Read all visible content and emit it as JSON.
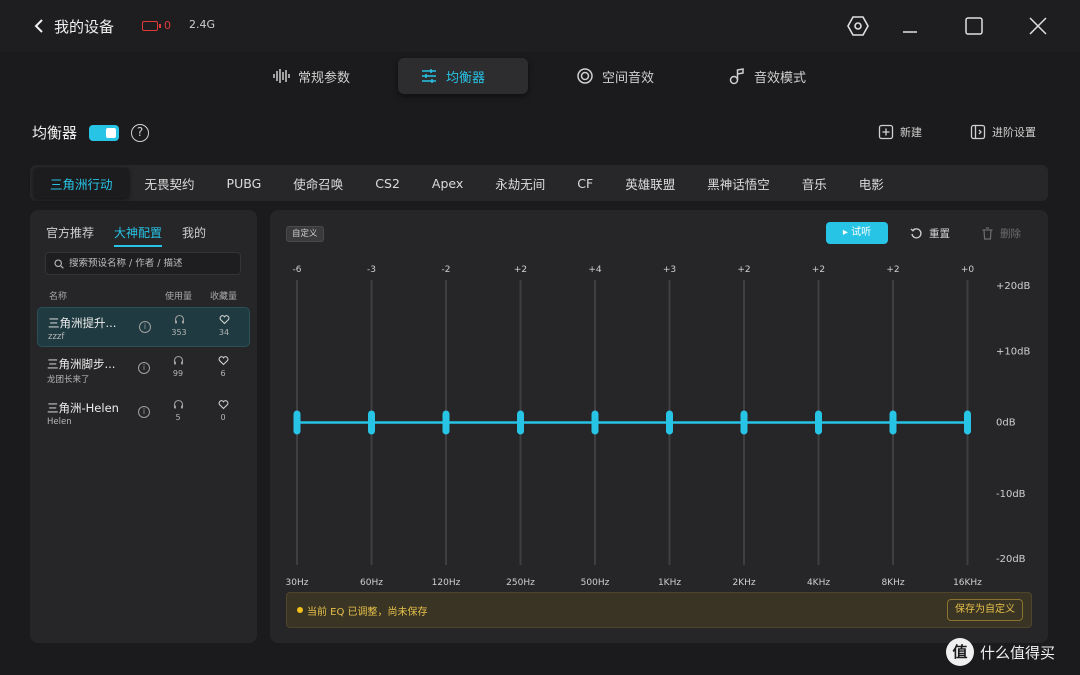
{
  "titlebar": {
    "back_label": "我的设备",
    "battery_value": "0",
    "connection": "2.4G"
  },
  "main_tabs": [
    {
      "label": "常规参数",
      "icon": "waveform-icon",
      "active": false
    },
    {
      "label": "均衡器",
      "icon": "sliders-icon",
      "active": true
    },
    {
      "label": "空间音效",
      "icon": "spatial-icon",
      "active": false
    },
    {
      "label": "音效模式",
      "icon": "music-note-icon",
      "active": false
    }
  ],
  "eq_header": {
    "title": "均衡器",
    "toggle_on": true,
    "help": "?",
    "new_label": "新建",
    "advanced_label": "进阶设置"
  },
  "game_tabs": [
    "三角洲行动",
    "无畏契约",
    "PUBG",
    "使命召唤",
    "CS2",
    "Apex",
    "永劫无间",
    "CF",
    "英雄联盟",
    "黑神话悟空",
    "音乐",
    "电影"
  ],
  "game_tabs_active": 0,
  "left_panel": {
    "tabs": [
      "官方推荐",
      "大神配置",
      "我的"
    ],
    "active_tab": 1,
    "search_placeholder": "搜索预设名称 / 作者 / 描述",
    "columns": {
      "name": "名称",
      "usage": "使用量",
      "favorites": "收藏量"
    },
    "presets": [
      {
        "name": "三角洲提升...",
        "author": "zzzf",
        "usage": "353",
        "favorites": "34",
        "selected": true
      },
      {
        "name": "三角洲脚步...",
        "author": "龙团长来了",
        "usage": "99",
        "favorites": "6",
        "selected": false
      },
      {
        "name": "三角洲-Helen",
        "author": "Helen",
        "usage": "5",
        "favorites": "0",
        "selected": false
      }
    ]
  },
  "eq_panel": {
    "badge": "自定义",
    "listen_label": "▸ 试听",
    "reset_label": "重置",
    "delete_label": "删除",
    "notice": "当前 EQ 已调整，尚未保存",
    "save_label": "保存为自定义"
  },
  "chart_data": {
    "type": "line",
    "x": [
      "30Hz",
      "60Hz",
      "120Hz",
      "250Hz",
      "500Hz",
      "1KHz",
      "2KHz",
      "4KHz",
      "8KHz",
      "16KHz"
    ],
    "band_value_labels": [
      "-6",
      "-3",
      "-2",
      "+2",
      "+4",
      "+3",
      "+2",
      "+2",
      "+2",
      "+0"
    ],
    "y_values": [
      0,
      0,
      0,
      0,
      0,
      0,
      0,
      0,
      0,
      0
    ],
    "y_tick_labels": [
      "+20dB",
      "+10dB",
      "0dB",
      "-10dB",
      "-20dB"
    ],
    "y_ticks": [
      20,
      10,
      0,
      -10,
      -20
    ],
    "ylim": [
      -20,
      20
    ],
    "line_color": "#27c4e6"
  },
  "watermark": {
    "logo": "值",
    "text": "什么值得买"
  },
  "colors": {
    "accent": "#27c4e6",
    "warning": "#e6c04a",
    "battery": "#e03a3a"
  }
}
